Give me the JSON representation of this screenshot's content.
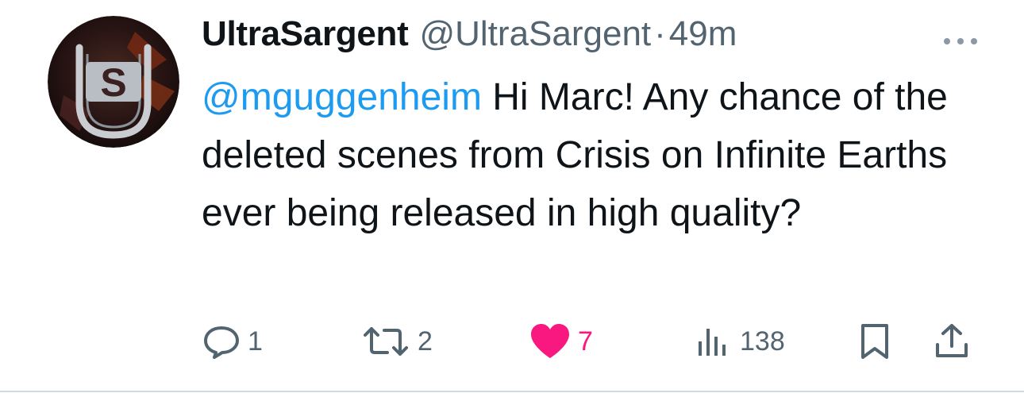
{
  "tweet": {
    "display_name": "UltraSargent",
    "handle": "@UltraSargent",
    "separator": "·",
    "time": "49m",
    "mention": "@mguggenheim",
    "text": " Hi Marc! Any chance of the deleted scenes from Crisis on Infinite Earths ever being released in high quality?",
    "avatar": {
      "letter": "S",
      "icon": "avatar-logo-icon"
    }
  },
  "actions": {
    "replies": {
      "icon": "reply-icon",
      "count": "1"
    },
    "retweets": {
      "icon": "retweet-icon",
      "count": "2"
    },
    "likes": {
      "icon": "heart-icon",
      "count": "7",
      "liked": true
    },
    "views": {
      "icon": "views-icon",
      "count": "138"
    },
    "bookmark": {
      "icon": "bookmark-icon"
    },
    "share": {
      "icon": "share-icon"
    },
    "more": {
      "icon": "more-dots-icon"
    }
  },
  "colors": {
    "text": "#0f1419",
    "secondary": "#536471",
    "mention": "#1d9bf0",
    "like": "#f91880",
    "divider": "#cfd9de"
  }
}
